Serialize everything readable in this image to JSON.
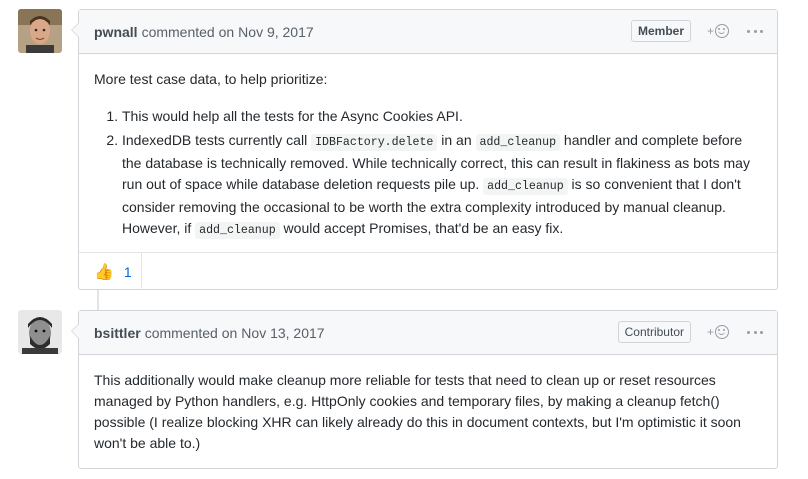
{
  "comments": [
    {
      "author": "pwnall",
      "action": "commented on",
      "date": "Nov 9, 2017",
      "badge": "Member",
      "intro": "More test case data, to help prioritize:",
      "list": {
        "item1": "This would help all the tests for the Async Cookies API.",
        "item2": {
          "t1": "IndexedDB tests currently call ",
          "c1": "IDBFactory.delete",
          "t2": " in an ",
          "c2": "add_cleanup",
          "t3": " handler and complete before the database is technically removed. While technically correct, this can result in flakiness as bots may run out of space while database deletion requests pile up. ",
          "c3": "add_cleanup",
          "t4": " is so convenient that I don't consider removing the occasional to be worth the extra complexity introduced by manual cleanup. However, if ",
          "c4": "add_cleanup",
          "t5": " would accept Promises, that'd be an easy fix."
        }
      },
      "reactions": [
        {
          "emoji": "thumbs-up",
          "glyph": "👍",
          "count": "1"
        }
      ]
    },
    {
      "author": "bsittler",
      "action": "commented on",
      "date": "Nov 13, 2017",
      "badge": "Contributor",
      "text": "This additionally would make cleanup more reliable for tests that need to clean up or reset resources managed by Python handlers, e.g. HttpOnly cookies and temporary files, by making a cleanup fetch() possible (I realize blocking XHR can likely already do this in document contexts, but I'm optimistic it soon won't be able to.)"
    }
  ],
  "icons": {
    "add_reaction": "smiley-plus-icon",
    "more": "kebab-horizontal-icon"
  },
  "colors": {
    "header_bg": "#f6f8fa",
    "border": "#d1d5da",
    "link": "#0366d6",
    "text": "#24292e"
  }
}
